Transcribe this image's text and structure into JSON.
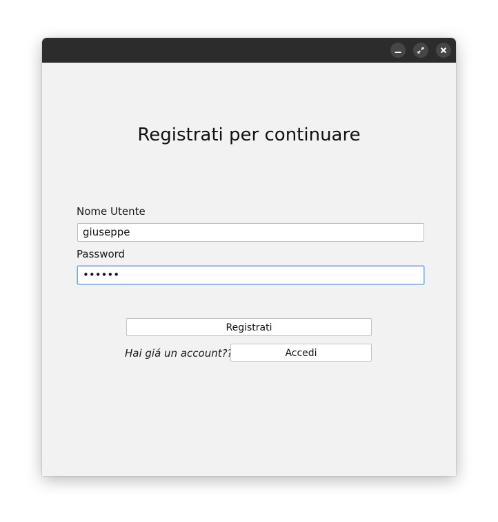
{
  "titlebar": {
    "buttons": [
      {
        "name": "minimize",
        "icon": "minimize-icon"
      },
      {
        "name": "maximize",
        "icon": "maximize-icon"
      },
      {
        "name": "close",
        "icon": "close-icon"
      }
    ]
  },
  "form": {
    "heading": "Registrati per continuare",
    "username": {
      "label": "Nome Utente",
      "value": "giuseppe"
    },
    "password": {
      "label": "Password",
      "masked_value": "••••••"
    },
    "register_label": "Registrati",
    "login_prompt": "Hai giá un account??",
    "login_label": "Accedi"
  },
  "colors": {
    "titlebar": "#2c2c2c",
    "window_bg": "#f2f2f2",
    "focus_ring": "#7fa8d6"
  }
}
